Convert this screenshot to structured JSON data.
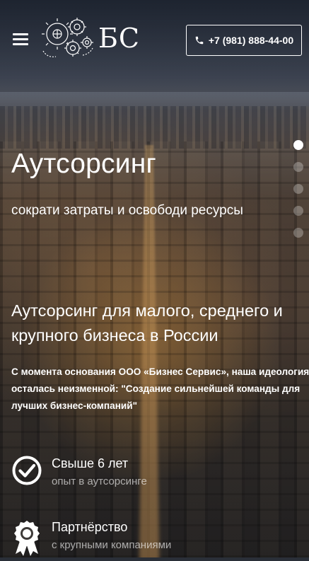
{
  "header": {
    "logo_text": "БС",
    "phone": "+7 (981) 888-44-00"
  },
  "slider": {
    "dot_count": 5,
    "active_index": 0
  },
  "hero": {
    "title": "Аутсорсинг",
    "subtitle": "сократи затраты и освободи ресурсы"
  },
  "about": {
    "title": "Аутсорсинг для малого, среднего и крупного бизнеса в России",
    "text": "С момента основания ООО «Бизнес Сервис», наша идеология осталась неизменной: \"Создание сильнейшей команды для лучших бизнес-компаний\""
  },
  "features": [
    {
      "title": "Свыше 6 лет",
      "subtitle": "опыт в аутсорсинге",
      "icon": "checkmark-circle-icon"
    },
    {
      "title": "Партнёрство",
      "subtitle": "с крупными компаниями",
      "icon": "award-badge-icon"
    }
  ],
  "colors": {
    "text": "#ffffff",
    "muted_text": "#bfbfbf"
  }
}
